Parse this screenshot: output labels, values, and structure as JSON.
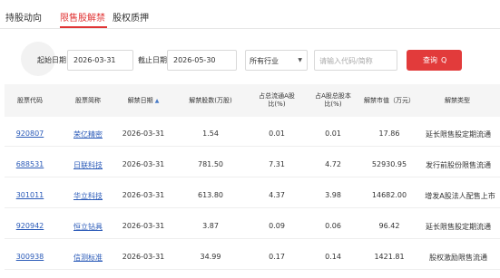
{
  "tabs": [
    {
      "label": "持股动向"
    },
    {
      "label": "限售股解禁"
    },
    {
      "label": "股权质押"
    }
  ],
  "active_tab": 1,
  "filter": {
    "start_label": "起始日期：",
    "start_value": "2026-03-31",
    "end_label": "截止日期：",
    "end_value": "2026-05-30",
    "industry_value": "所有行业",
    "search_placeholder": "请输入代码/简称",
    "search_button": "查询",
    "accent_color": "#e23b3b"
  },
  "table": {
    "headers": [
      "股票代码",
      "股票简称",
      "解禁日期",
      "解禁股数(万股)",
      "占总流通A股\n比(%)",
      "占A股总股本\n比(%)",
      "解禁市值（万元）",
      "解禁类型"
    ],
    "sort_icon": "sort-up-icon",
    "rows": [
      [
        "920807",
        "荣亿精密",
        "2026-03-31",
        "1.54",
        "0.01",
        "0.01",
        "17.86",
        "延长限售股定期流通"
      ],
      [
        "688531",
        "日联科技",
        "2026-03-31",
        "781.50",
        "7.31",
        "4.72",
        "52930.95",
        "发行前股份限售流通"
      ],
      [
        "301011",
        "华立科技",
        "2026-03-31",
        "613.80",
        "4.37",
        "3.98",
        "14682.00",
        "增发A股法人配售上市"
      ],
      [
        "920942",
        "恒立钻具",
        "2026-03-31",
        "3.87",
        "0.09",
        "0.06",
        "96.42",
        "延长限售股定期流通"
      ],
      [
        "300938",
        "信测标准",
        "2026-03-31",
        "34.99",
        "0.17",
        "0.14",
        "1421.81",
        "股权激励限售流通"
      ]
    ]
  },
  "link_color": "#2a5ab8"
}
